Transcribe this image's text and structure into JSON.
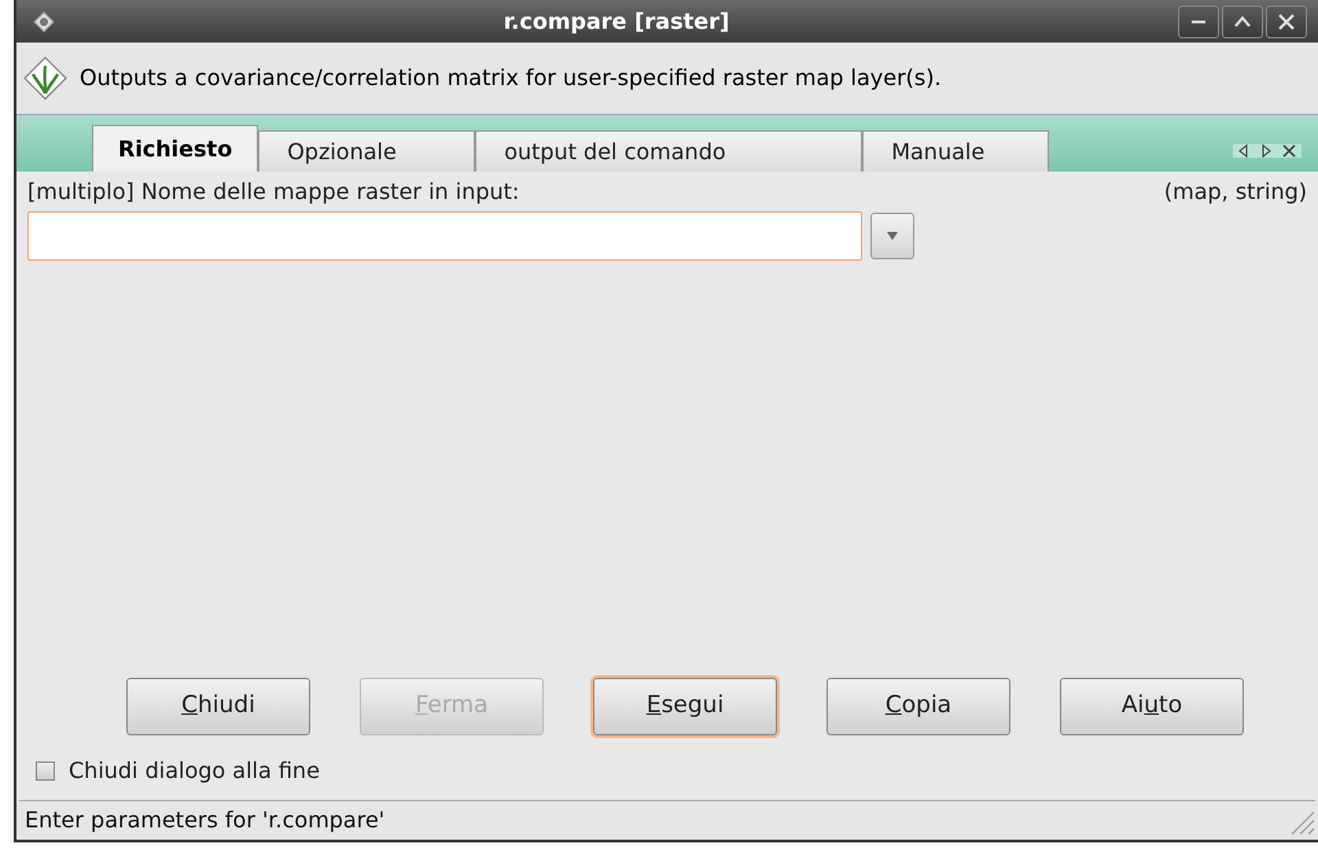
{
  "window": {
    "title": "r.compare [raster]"
  },
  "description": "Outputs a covariance/correlation matrix for user-specified raster map layer(s).",
  "tabs": [
    {
      "label": "Richiesto",
      "selected": true
    },
    {
      "label": "Opzionale",
      "selected": false
    },
    {
      "label": "output del comando",
      "selected": false
    },
    {
      "label": "Manuale",
      "selected": false
    }
  ],
  "field": {
    "label": "[multiplo] Nome delle mappe raster in input:",
    "type_hint": "(map, string)"
  },
  "buttons": [
    {
      "key": "C",
      "post": "hiudi",
      "disabled": false,
      "focused": false
    },
    {
      "key": "F",
      "post": "erma",
      "disabled": true,
      "focused": false
    },
    {
      "key": "E",
      "post": "segui",
      "disabled": false,
      "focused": true
    },
    {
      "key": "C",
      "post": "opia",
      "disabled": false,
      "focused": false
    },
    {
      "pre": "Ai",
      "key": "u",
      "post": "to",
      "disabled": false,
      "focused": false
    }
  ],
  "close_on_finish": {
    "label": "Chiudi dialogo alla fine",
    "checked": false
  },
  "status_bar": "Enter parameters for 'r.compare'"
}
